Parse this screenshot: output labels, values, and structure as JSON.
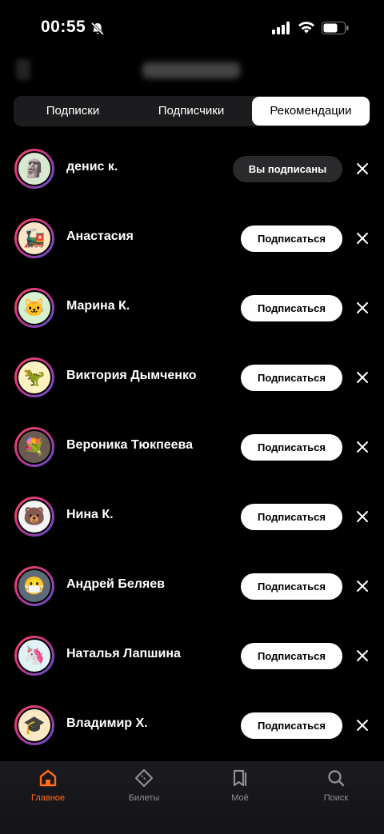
{
  "status_bar": {
    "time": "00:55"
  },
  "segments": {
    "tabs": [
      {
        "label": "Подписки"
      },
      {
        "label": "Подписчики"
      },
      {
        "label": "Рекомендации"
      }
    ]
  },
  "people": [
    {
      "name": "денис к.",
      "button": "Вы подписаны",
      "avatar": "🗿",
      "bg": "#d9e8d0",
      "state": "following"
    },
    {
      "name": "Анастасия",
      "button": "Подписаться",
      "avatar": "🚂",
      "bg": "#fbe6c8",
      "state": "follow"
    },
    {
      "name": "Марина К.",
      "button": "Подписаться",
      "avatar": "🐱",
      "bg": "#d6f0d0",
      "state": "follow"
    },
    {
      "name": "Виктория Дымченко",
      "button": "Подписаться",
      "avatar": "🦖",
      "bg": "#fff2c2",
      "state": "follow"
    },
    {
      "name": "Вероника Тюкпеева",
      "button": "Подписаться",
      "avatar": "💐",
      "bg": "#6b5a52",
      "state": "follow"
    },
    {
      "name": "Нина К.",
      "button": "Подписаться",
      "avatar": "🐻",
      "bg": "#f4f4f4",
      "state": "follow"
    },
    {
      "name": "Андрей Беляев",
      "button": "Подписаться",
      "avatar": "😷",
      "bg": "#5d6a78",
      "state": "follow"
    },
    {
      "name": "Наталья Лапшина",
      "button": "Подписаться",
      "avatar": "🦄",
      "bg": "#e2f3f6",
      "state": "follow"
    },
    {
      "name": "Владимир Х.",
      "button": "Подписаться",
      "avatar": "🎓",
      "bg": "#fbe9c6",
      "state": "follow"
    }
  ],
  "tabbar": {
    "items": [
      {
        "label": "Главное",
        "icon": "home-icon"
      },
      {
        "label": "Билеты",
        "icon": "ticket-icon"
      },
      {
        "label": "Моё",
        "icon": "bookmark-icon"
      },
      {
        "label": "Поиск",
        "icon": "search-icon"
      }
    ],
    "active_color": "#ff6a1a"
  }
}
